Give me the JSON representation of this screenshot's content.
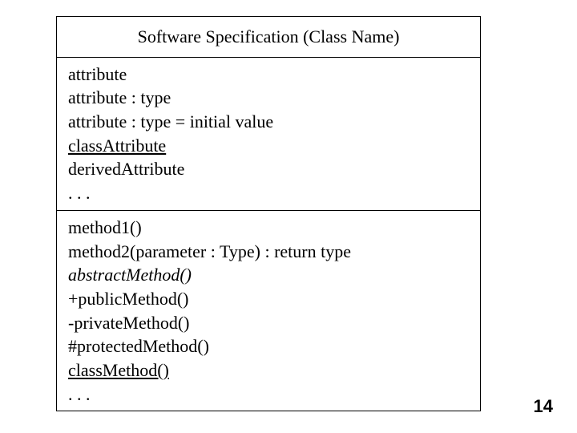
{
  "title": "Software Specification (Class Name)",
  "attributes": {
    "a1": "attribute",
    "a2": "attribute : type",
    "a3": "attribute : type = initial value",
    "a4": "classAttribute",
    "a5": "derivedAttribute",
    "a6": ". . ."
  },
  "methods": {
    "m1": "method1()",
    "m2": "method2(parameter : Type) : return type",
    "m3": "abstractMethod()",
    "m4": "+publicMethod()",
    "m5": "-privateMethod()",
    "m6": "#protectedMethod()",
    "m7": "classMethod()",
    "m8": ". . ."
  },
  "page": "14"
}
